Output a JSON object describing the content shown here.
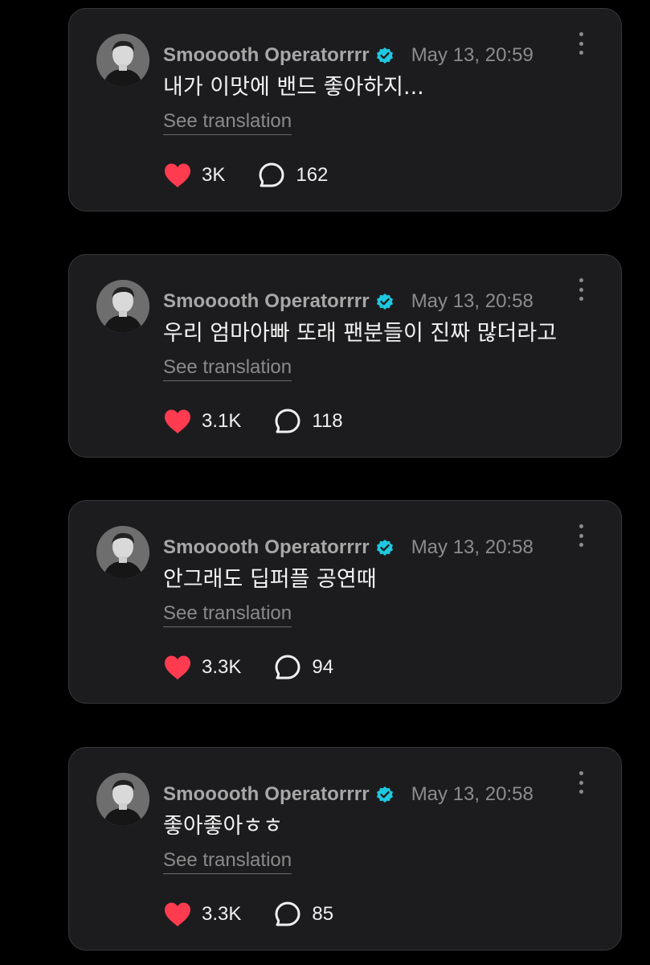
{
  "colors": {
    "background": "#000000",
    "card": "#1c1c1e",
    "card_border": "#38383a",
    "heart": "#ff3b4f",
    "verified": "#1ec8e0"
  },
  "icons": {
    "like": "heart-icon",
    "reply": "reply-bubble-icon",
    "verified": "verified-badge-icon",
    "more": "more-vertical-icon"
  },
  "posts": [
    {
      "username": "Smooooth Operatorrrr",
      "timestamp": "May 13, 20:59",
      "text": "내가 이맛에 밴드 좋아하지...",
      "see_translation": "See translation",
      "likes": "3K",
      "replies": "162"
    },
    {
      "username": "Smooooth Operatorrrr",
      "timestamp": "May 13, 20:58",
      "text": "우리 엄마아빠 또래 팬분들이 진짜 많더라고",
      "see_translation": "See translation",
      "likes": "3.1K",
      "replies": "118"
    },
    {
      "username": "Smooooth Operatorrrr",
      "timestamp": "May 13, 20:58",
      "text": "안그래도 딥퍼플 공연때",
      "see_translation": "See translation",
      "likes": "3.3K",
      "replies": "94"
    },
    {
      "username": "Smooooth Operatorrrr",
      "timestamp": "May 13, 20:58",
      "text": "좋아좋아ㅎㅎ",
      "see_translation": "See translation",
      "likes": "3.3K",
      "replies": "85"
    }
  ]
}
